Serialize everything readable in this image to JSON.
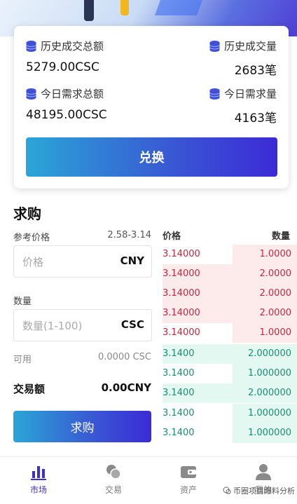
{
  "stats": {
    "hist_total_label": "历史成交总额",
    "hist_total_value": "5279.00CSC",
    "hist_volume_label": "历史成交量",
    "hist_volume_value": "2683笔",
    "today_total_label": "今日需求总额",
    "today_total_value": "48195.00CSC",
    "today_volume_label": "今日需求量",
    "today_volume_value": "4163笔"
  },
  "exchange_label": "兑换",
  "buy_form": {
    "title": "求购",
    "ref_price_label": "参考价格",
    "ref_price_range": "2.58-3.14",
    "price_placeholder": "价格",
    "price_unit": "CNY",
    "qty_label": "数量",
    "qty_placeholder": "数量(1-100)",
    "qty_unit": "CSC",
    "available_label": "可用",
    "available_value": "0.0000 CSC",
    "trade_amount_label": "交易额",
    "trade_amount_value": "0.00CNY",
    "submit_label": "求购"
  },
  "orderbook": {
    "price_header": "价格",
    "qty_header": "数量",
    "sell": [
      {
        "price": "3.14000",
        "qty": "1.0000"
      },
      {
        "price": "3.14000",
        "qty": "2.0000"
      },
      {
        "price": "3.14000",
        "qty": "2.0000"
      },
      {
        "price": "3.14000",
        "qty": "2.0000"
      },
      {
        "price": "3.14000",
        "qty": "1.0000"
      }
    ],
    "buy": [
      {
        "price": "3.1400",
        "qty": "2.000000"
      },
      {
        "price": "3.1400",
        "qty": "1.000000"
      },
      {
        "price": "3.1400",
        "qty": "2.000000"
      },
      {
        "price": "3.1400",
        "qty": "1.000000"
      },
      {
        "price": "3.1400",
        "qty": "1.000000"
      }
    ],
    "sell_color": "#c0283e",
    "buy_color": "#1a8e6e"
  },
  "tabs": [
    {
      "label": "市场",
      "icon": "bar-chart-icon"
    },
    {
      "label": "交易",
      "icon": "coins-icon"
    },
    {
      "label": "资产",
      "icon": "wallet-icon"
    },
    {
      "label": "我的",
      "icon": "user-icon"
    }
  ],
  "watermark": "币圈项目爆料分析",
  "colors": {
    "accent": "#3b30c8",
    "gradient_start": "#2aa6d6",
    "gradient_end": "#3b2bd6"
  }
}
